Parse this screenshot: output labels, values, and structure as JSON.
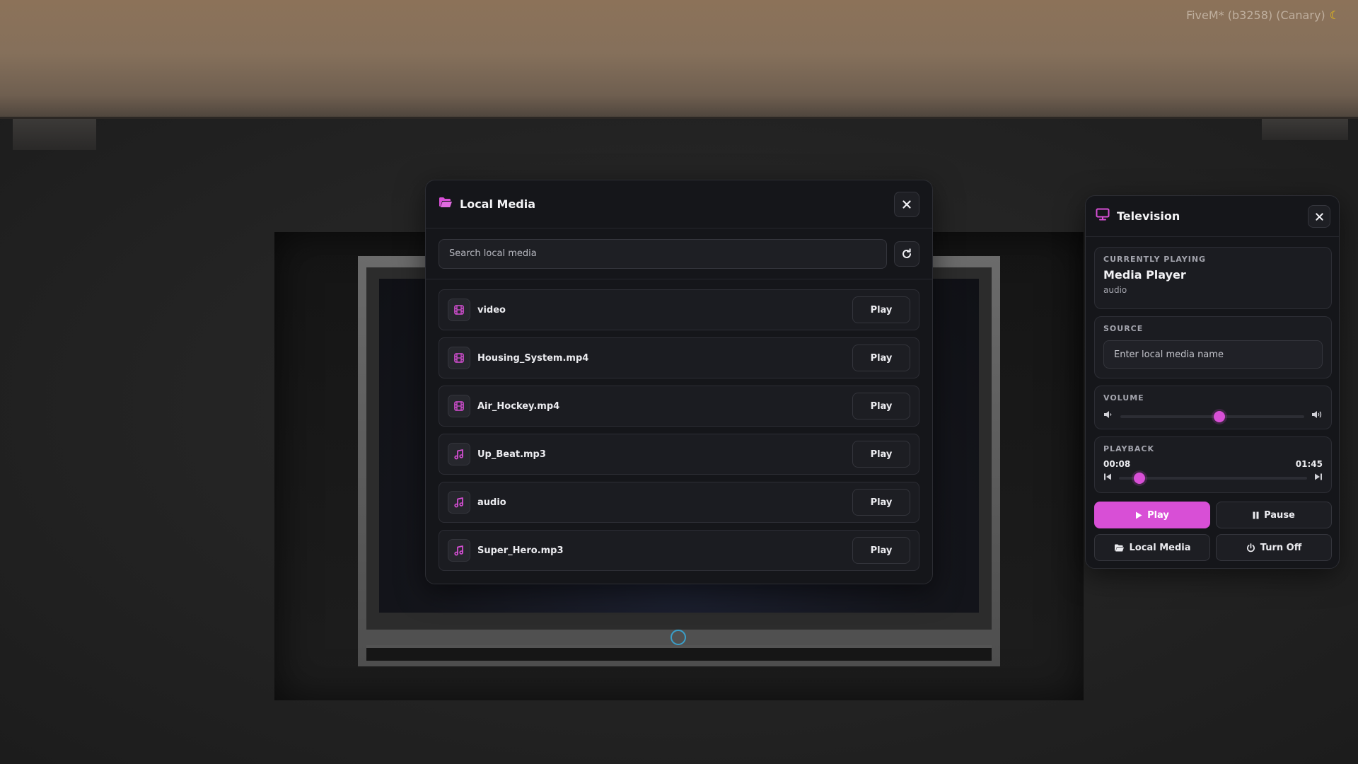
{
  "overlay": {
    "version": "FiveM* (b3258) (Canary)"
  },
  "local_media": {
    "title": "Local Media",
    "search_placeholder": "Search local media",
    "items": [
      {
        "name": "video",
        "kind": "video",
        "action": "Play"
      },
      {
        "name": "Housing_System.mp4",
        "kind": "video",
        "action": "Play"
      },
      {
        "name": "Air_Hockey.mp4",
        "kind": "video",
        "action": "Play"
      },
      {
        "name": "Up_Beat.mp3",
        "kind": "audio",
        "action": "Play"
      },
      {
        "name": "audio",
        "kind": "audio",
        "action": "Play"
      },
      {
        "name": "Super_Hero.mp3",
        "kind": "audio",
        "action": "Play"
      }
    ]
  },
  "television": {
    "title": "Television",
    "currently_playing": {
      "label": "CURRENTLY PLAYING",
      "title": "Media Player",
      "type": "audio"
    },
    "source": {
      "label": "SOURCE",
      "placeholder": "Enter local media name"
    },
    "volume": {
      "label": "VOLUME",
      "level": 0.54
    },
    "playback": {
      "label": "PLAYBACK",
      "current": "00:08",
      "total": "01:45",
      "progress": 0.11
    },
    "buttons": {
      "play": "Play",
      "pause": "Pause",
      "local_media": "Local Media",
      "turn_off": "Turn Off"
    }
  },
  "colors": {
    "accent": "#d84fd6",
    "panel_bg": "#15161a"
  },
  "icons": {
    "modal": "folder-open-icon",
    "video": "film-icon",
    "audio": "music-note-icon",
    "refresh": "refresh-icon",
    "close": "close-icon",
    "tv": "monitor-icon"
  }
}
